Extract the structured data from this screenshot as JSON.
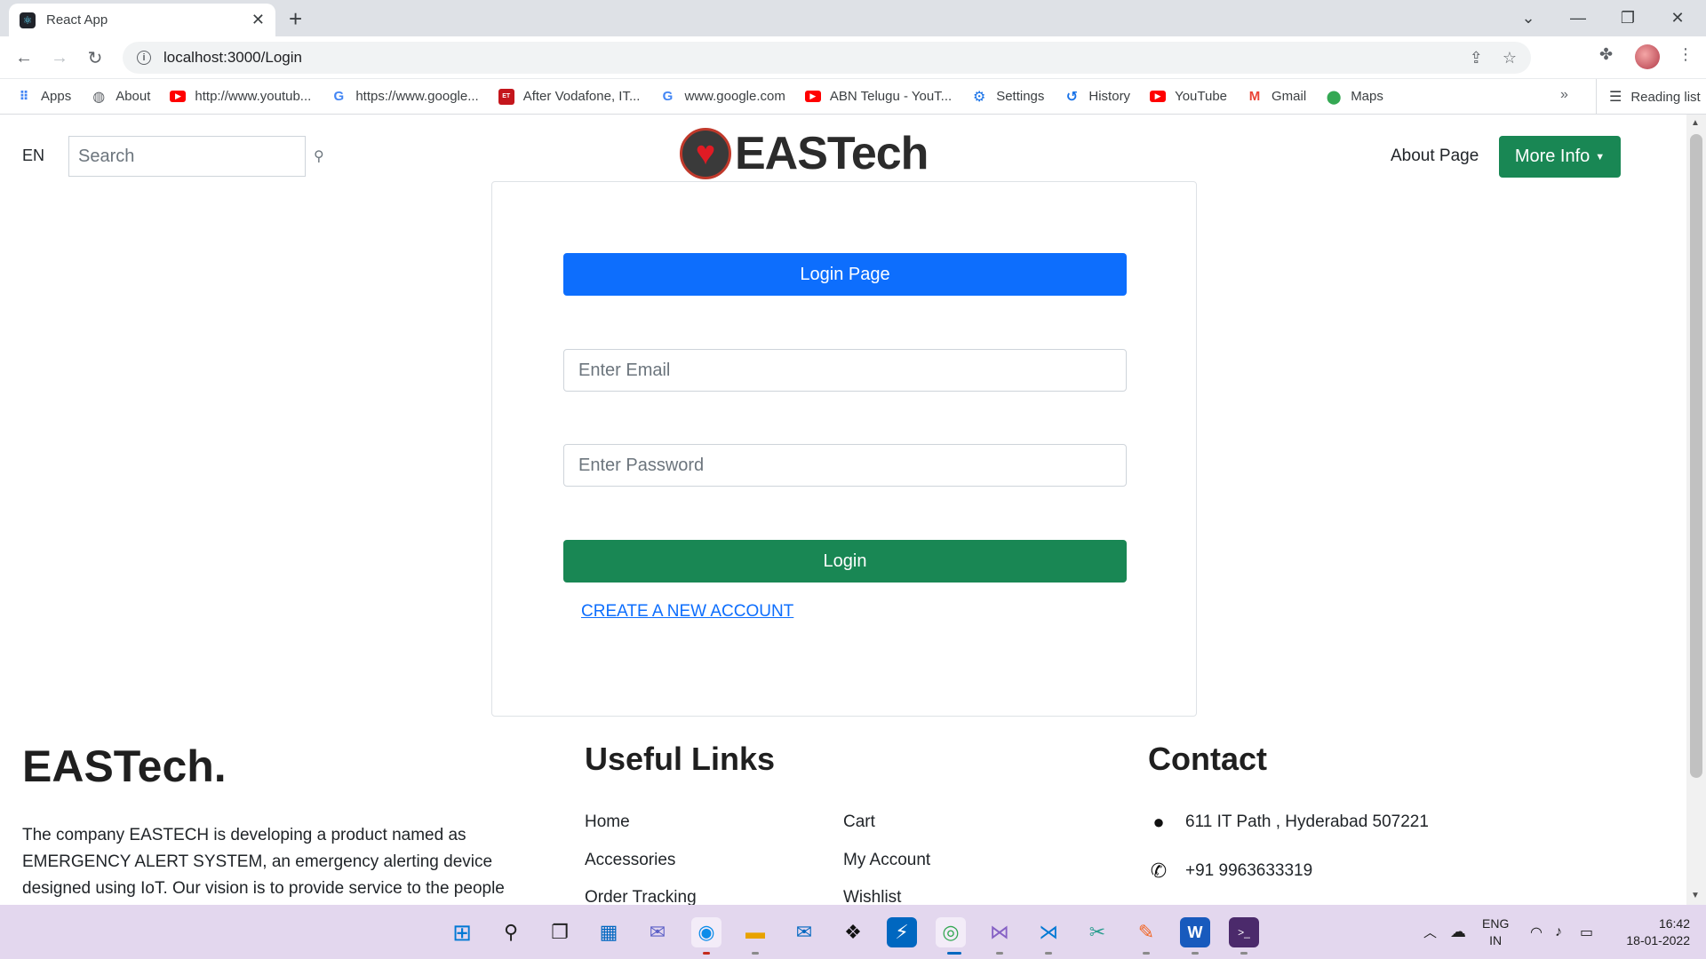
{
  "browser": {
    "tab_title": "React App",
    "url": "localhost:3000/Login",
    "bookmarks": [
      {
        "label": "Apps",
        "icon": "apps-grid-icon"
      },
      {
        "label": "About",
        "icon": "globe-icon"
      },
      {
        "label": "http://www.youtub...",
        "icon": "youtube-icon"
      },
      {
        "label": "https://www.google...",
        "icon": "google-icon"
      },
      {
        "label": "After Vodafone, IT...",
        "icon": "news-icon"
      },
      {
        "label": "www.google.com",
        "icon": "google-icon"
      },
      {
        "label": "ABN Telugu - YouT...",
        "icon": "youtube-icon"
      },
      {
        "label": "Settings",
        "icon": "gear-icon"
      },
      {
        "label": "History",
        "icon": "history-icon"
      },
      {
        "label": "YouTube",
        "icon": "youtube-icon"
      },
      {
        "label": "Gmail",
        "icon": "gmail-icon"
      },
      {
        "label": "Maps",
        "icon": "maps-icon"
      }
    ],
    "more_bookmarks": "»",
    "reading_list": "Reading list"
  },
  "header": {
    "lang": "EN",
    "search_placeholder": "Search",
    "brand": "EASTech",
    "about_link": "About Page",
    "more_info": "More Info"
  },
  "login": {
    "title_button": "Login Page",
    "email_placeholder": "Enter Email",
    "password_placeholder": "Enter Password",
    "login_button": "Login",
    "create_account": "CREATE A NEW ACCOUNT"
  },
  "footer": {
    "brand": "EASTech.",
    "description": "The company EASTECH is developing a product named as EMERGENCY ALERT SYSTEM, an emergency alerting device designed using IoT. Our vision is to provide service to the people",
    "useful_links_title": "Useful Links",
    "links_col1": [
      "Home",
      "Accessories",
      "Order Tracking"
    ],
    "links_col2": [
      "Cart",
      "My Account",
      "Wishlist"
    ],
    "contact_title": "Contact",
    "address": "611 IT Path , Hyderabad 507221",
    "phone": "+91 9963633319"
  },
  "taskbar": {
    "lang_line1": "ENG",
    "lang_line2": "IN",
    "time": "16:42",
    "date": "18-01-2022"
  }
}
